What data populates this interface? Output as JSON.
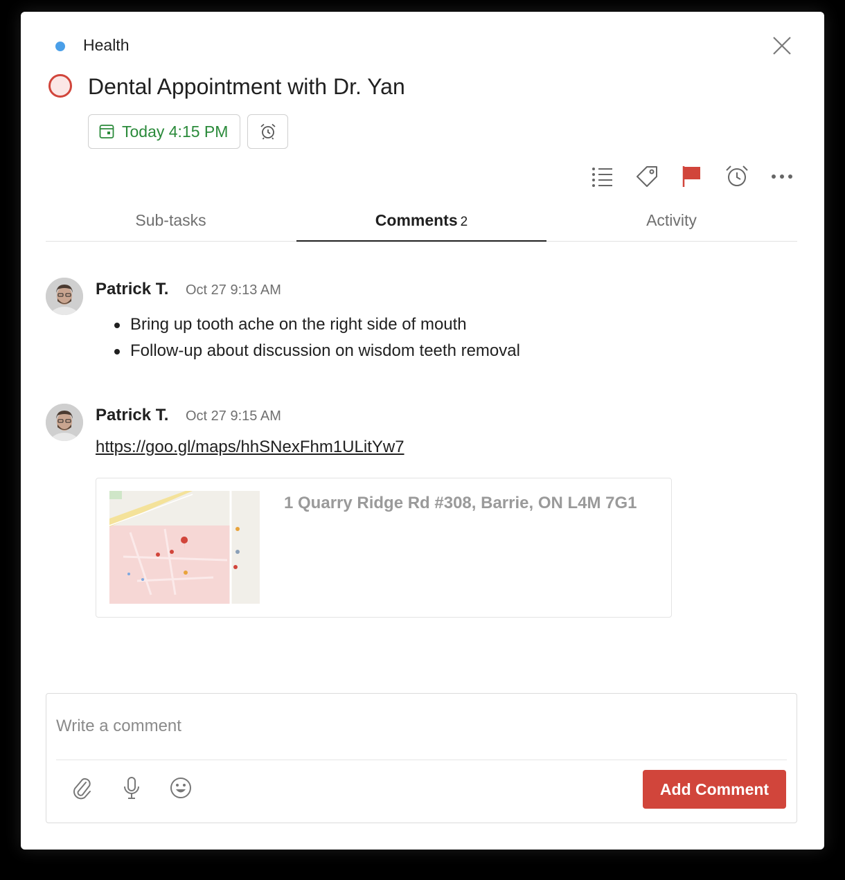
{
  "project": {
    "name": "Health",
    "color": "#4a9fe8"
  },
  "task": {
    "title": "Dental Appointment with Dr. Yan",
    "due_label": "Today 4:15 PM",
    "priority_color": "#d1453b"
  },
  "toolbar": {
    "icons": [
      "list-icon",
      "tag-icon",
      "flag-icon",
      "alarm-icon",
      "more-icon"
    ]
  },
  "tabs": [
    {
      "label": "Sub-tasks"
    },
    {
      "label": "Comments",
      "count": "2"
    },
    {
      "label": "Activity"
    }
  ],
  "comments": [
    {
      "author": "Patrick T.",
      "time": "Oct 27 9:13 AM",
      "bullets": [
        "Bring up tooth ache on the right side of mouth",
        "Follow-up about discussion on wisdom teeth removal"
      ]
    },
    {
      "author": "Patrick T.",
      "time": "Oct 27 9:15 AM",
      "link": "https://goo.gl/maps/hhSNexFhm1ULitYw7",
      "preview": {
        "address": "1 Quarry Ridge Rd #308, Barrie, ON L4M 7G1"
      }
    }
  ],
  "composer": {
    "placeholder": "Write a comment",
    "add_label": "Add Comment",
    "icons": [
      "attachment-icon",
      "microphone-icon",
      "emoji-icon"
    ]
  }
}
